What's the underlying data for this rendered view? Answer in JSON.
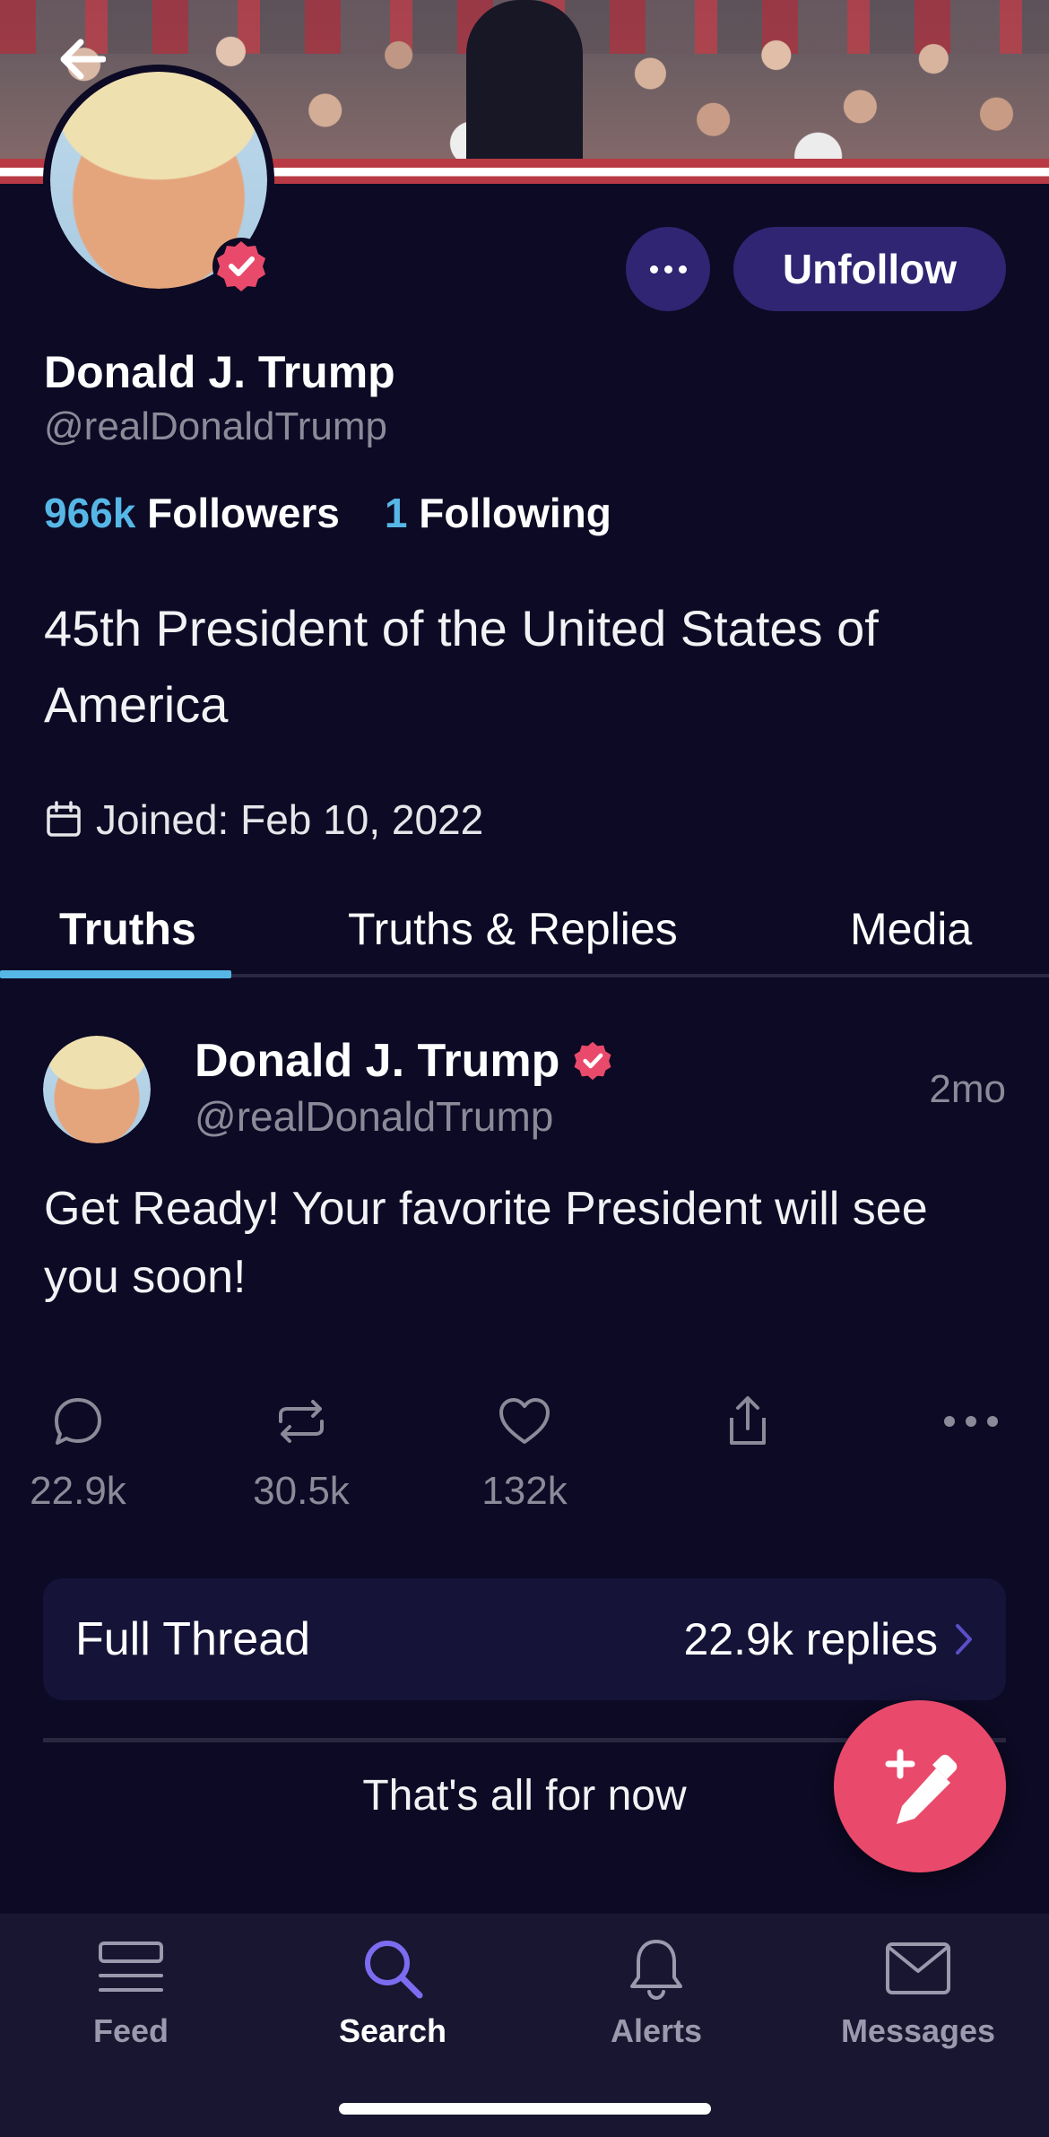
{
  "profile": {
    "name": "Donald J. Trump",
    "handle": "@realDonaldTrump",
    "followers_count": "966k",
    "followers_label": "Followers",
    "following_count": "1",
    "following_label": "Following",
    "bio": "45th President of the United States of America",
    "joined": "Joined: Feb 10, 2022",
    "verified": true
  },
  "actions": {
    "unfollow_label": "Unfollow"
  },
  "tabs": [
    {
      "label": "Truths",
      "active": true
    },
    {
      "label": "Truths & Replies",
      "active": false
    },
    {
      "label": "Media",
      "active": false
    }
  ],
  "post": {
    "author_name": "Donald J. Trump",
    "author_handle": "@realDonaldTrump",
    "time": "2mo",
    "text": "Get Ready! Your favorite President will see you soon!",
    "replies": "22.9k",
    "retruths": "30.5k",
    "likes": "132k"
  },
  "thread": {
    "title": "Full Thread",
    "replies": "22.9k replies"
  },
  "end_message": "That's all for now",
  "nav": [
    {
      "label": "Feed",
      "icon": "feed-icon",
      "active": false
    },
    {
      "label": "Search",
      "icon": "search-icon",
      "active": true
    },
    {
      "label": "Alerts",
      "icon": "bell-icon",
      "active": false
    },
    {
      "label": "Messages",
      "icon": "envelope-icon",
      "active": false
    }
  ],
  "colors": {
    "background": "#0c0a24",
    "accent_blue": "#56b7e6",
    "button_purple": "#2f2573",
    "verified_red": "#e94a6b",
    "fab_pink": "#e94a6b",
    "nav_active": "#7b6cf0"
  }
}
